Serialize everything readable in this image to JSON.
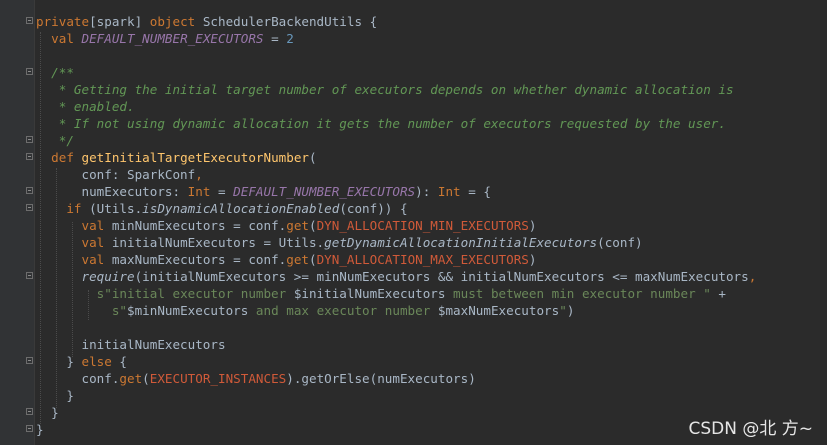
{
  "editor": {
    "lines": [
      [
        [
          "kw",
          "private"
        ],
        [
          "pl",
          "[spark] "
        ],
        [
          "kw",
          "object "
        ],
        [
          "pl",
          "SchedulerBackendUtils {"
        ]
      ],
      [
        [
          "pl",
          "  "
        ],
        [
          "kw",
          "val "
        ],
        [
          "cn",
          "DEFAULT_NUMBER_EXECUTORS"
        ],
        [
          "pl",
          " = "
        ],
        [
          "num",
          "2"
        ]
      ],
      [
        [
          "pl",
          ""
        ]
      ],
      [
        [
          "pl",
          "  "
        ],
        [
          "cm",
          "/**"
        ]
      ],
      [
        [
          "cm",
          "   * Getting the initial target number of executors depends on whether dynamic allocation is"
        ]
      ],
      [
        [
          "cm",
          "   * enabled."
        ]
      ],
      [
        [
          "cm",
          "   * If not using dynamic allocation it gets the number of executors requested by the user."
        ]
      ],
      [
        [
          "cm",
          "   */"
        ]
      ],
      [
        [
          "pl",
          "  "
        ],
        [
          "kw",
          "def "
        ],
        [
          "fn",
          "getInitialTargetExecutorNumber"
        ],
        [
          "pl",
          "("
        ]
      ],
      [
        [
          "pl",
          "      conf: SparkConf"
        ],
        [
          "kw",
          ","
        ]
      ],
      [
        [
          "pl",
          "      numExecutors: "
        ],
        [
          "kw",
          "Int"
        ],
        [
          "pl",
          " = "
        ],
        [
          "cn",
          "DEFAULT_NUMBER_EXECUTORS"
        ],
        [
          "pl",
          "): "
        ],
        [
          "kw",
          "Int"
        ],
        [
          "pl",
          " = {"
        ]
      ],
      [
        [
          "pl",
          "    "
        ],
        [
          "kw",
          "if "
        ],
        [
          "pl",
          "(Utils."
        ],
        [
          "it",
          "isDynamicAllocationEnabled"
        ],
        [
          "pl",
          "(conf)) {"
        ]
      ],
      [
        [
          "pl",
          "      "
        ],
        [
          "kw",
          "val "
        ],
        [
          "pl",
          "minNumExecutors = conf."
        ],
        [
          "kw",
          "get"
        ],
        [
          "pl",
          "("
        ],
        [
          "err",
          "DYN_ALLOCATION_MIN_EXECUTORS"
        ],
        [
          "pl",
          ")"
        ]
      ],
      [
        [
          "pl",
          "      "
        ],
        [
          "kw",
          "val "
        ],
        [
          "pl",
          "initialNumExecutors = Utils."
        ],
        [
          "it",
          "getDynamicAllocationInitialExecutors"
        ],
        [
          "pl",
          "(conf)"
        ]
      ],
      [
        [
          "pl",
          "      "
        ],
        [
          "kw",
          "val "
        ],
        [
          "pl",
          "maxNumExecutors = conf."
        ],
        [
          "kw",
          "get"
        ],
        [
          "pl",
          "("
        ],
        [
          "err",
          "DYN_ALLOCATION_MAX_EXECUTORS"
        ],
        [
          "pl",
          ")"
        ]
      ],
      [
        [
          "pl",
          "      "
        ],
        [
          "it",
          "require"
        ],
        [
          "pl",
          "(initialNumExecutors >= minNumExecutors && initialNumExecutors <= maxNumExecutors"
        ],
        [
          "kw",
          ","
        ]
      ],
      [
        [
          "pl",
          "        "
        ],
        [
          "str",
          "s\"initial executor number "
        ],
        [
          "pl",
          "$initialNumExecutors"
        ],
        [
          "str",
          " must between min executor number \""
        ],
        [
          "pl",
          " +"
        ]
      ],
      [
        [
          "pl",
          "          "
        ],
        [
          "str",
          "s\""
        ],
        [
          "pl",
          "$minNumExecutors"
        ],
        [
          "str",
          " and max executor number "
        ],
        [
          "pl",
          "$maxNumExecutors"
        ],
        [
          "str",
          "\""
        ],
        [
          "pl",
          ")"
        ]
      ],
      [
        [
          "pl",
          ""
        ]
      ],
      [
        [
          "pl",
          "      initialNumExecutors"
        ]
      ],
      [
        [
          "pl",
          "    } "
        ],
        [
          "kw",
          "else "
        ],
        [
          "pl",
          "{"
        ]
      ],
      [
        [
          "pl",
          "      conf."
        ],
        [
          "kw",
          "get"
        ],
        [
          "pl",
          "("
        ],
        [
          "err",
          "EXECUTOR_INSTANCES"
        ],
        [
          "pl",
          ").getOrElse(numExecutors)"
        ]
      ],
      [
        [
          "pl",
          "    }"
        ]
      ],
      [
        [
          "pl",
          "  }"
        ]
      ],
      [
        [
          "pl",
          "}"
        ]
      ]
    ]
  },
  "watermark": "CSDN @北 方~"
}
